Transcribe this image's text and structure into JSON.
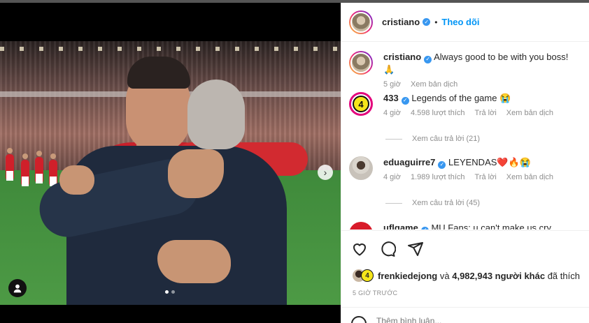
{
  "post": {
    "author": "cristiano",
    "separator": "•",
    "follow_label": "Theo dõi"
  },
  "media": {
    "next_glyph": "›",
    "dots_count": 2,
    "active_dot": 0
  },
  "comments": [
    {
      "username": "cristiano",
      "text": "Always good to be with you boss! 🙏",
      "time": "5 giờ",
      "translate": "Xem bản dịch"
    },
    {
      "username": "433",
      "avatar_text": "4",
      "text": "Legends of the game 😭",
      "time": "4 giờ",
      "likes": "4.598 lượt thích",
      "reply": "Trả lời",
      "translate": "Xem bản dịch",
      "view_replies": "Xem câu trả lời (21)"
    },
    {
      "username": "eduaguirre7",
      "text": "LEYENDAS❤️🔥😭",
      "time": "4 giờ",
      "likes": "1.989 lượt thích",
      "reply": "Trả lời",
      "translate": "Xem bản dịch",
      "view_replies": "Xem câu trả lời (45)"
    },
    {
      "username": "uflgame",
      "text": "MU Fans: u can't make us cry"
    }
  ],
  "actions": {
    "liked_by_user": "frenkiedejong",
    "liked_by_connector": "và",
    "liked_by_others": "4,982,943 người khác",
    "liked_suffix": "đã thích",
    "mini_avatar_text": "4",
    "time_ago": "5 GIỜ TRƯỚC",
    "comment_placeholder": "Thêm bình luận..."
  },
  "colors": {
    "accent": "#0095f6",
    "verified": "#3897f0",
    "muted": "#8e8e8e"
  }
}
